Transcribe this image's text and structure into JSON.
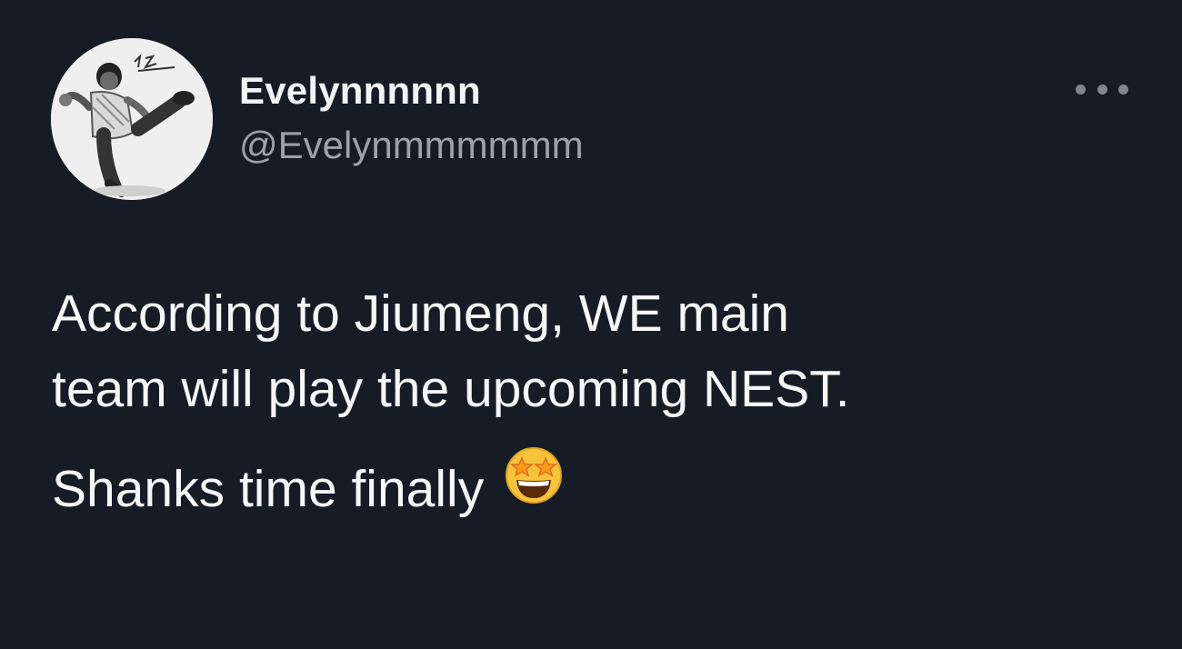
{
  "user": {
    "display_name": "Evelynnnnnn",
    "handle": "@Evelynmmmmmm",
    "avatar_icon": "person-jumping-photo"
  },
  "menu": {
    "icon": "more-options-icon"
  },
  "tweet": {
    "line1": "According to Jiumeng, WE main",
    "line2": "team will play the upcoming NEST.",
    "line3": "Shanks time finally",
    "emoji": "star-struck-emoji"
  },
  "colors": {
    "background": "#161c26",
    "name": "#f2f3f5",
    "handle": "#9aa3ad",
    "text": "#f5f6f7"
  }
}
